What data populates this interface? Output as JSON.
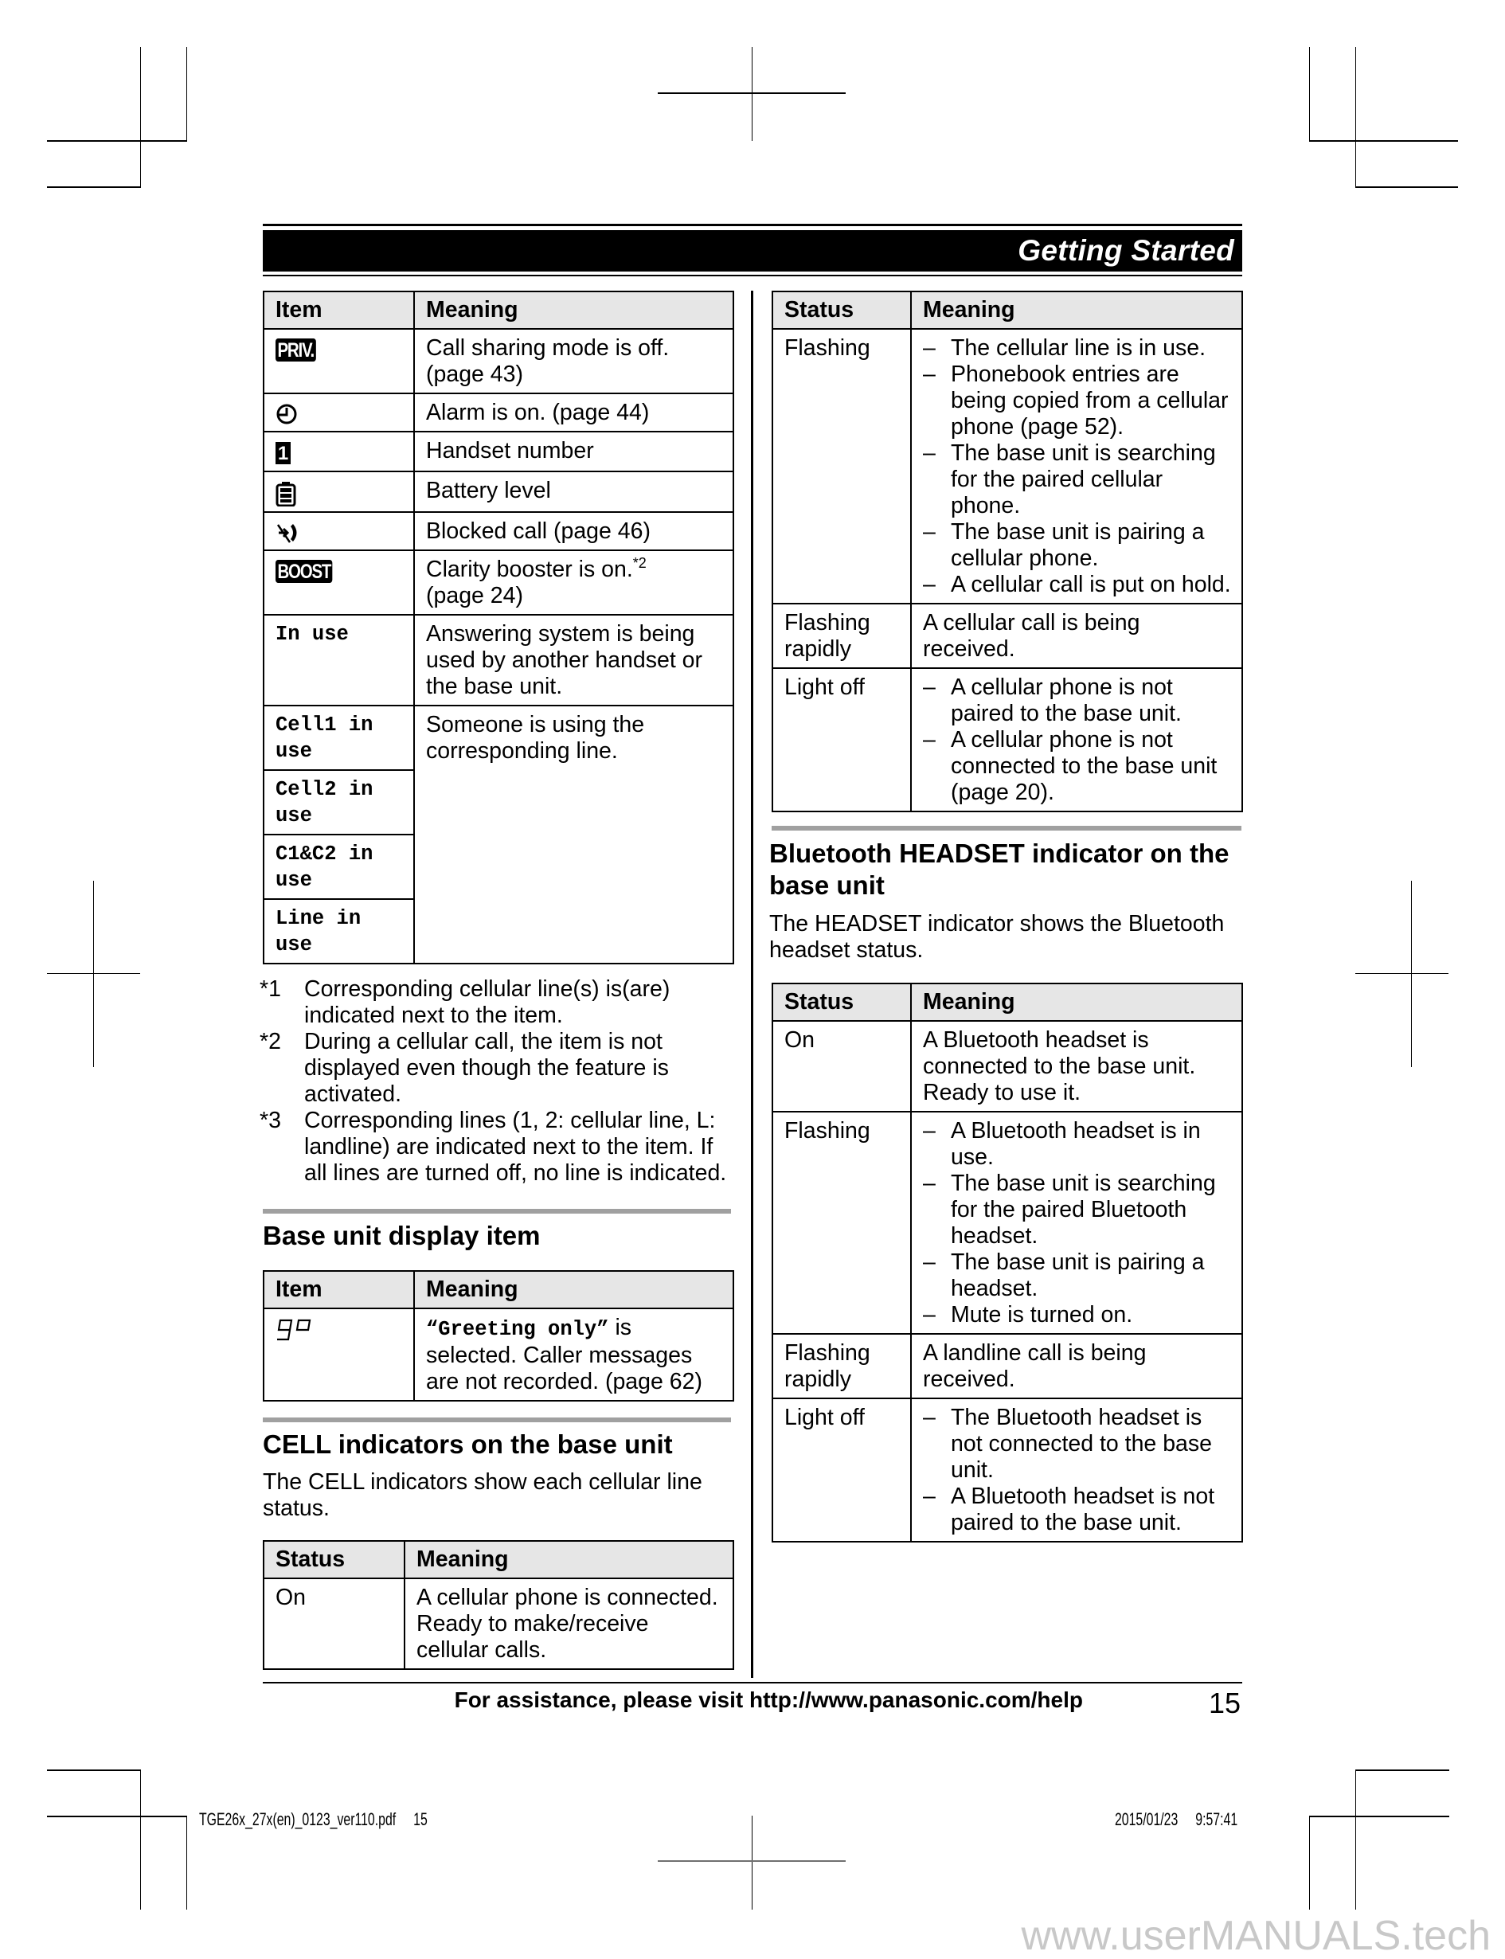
{
  "header": {
    "section_title": "Getting Started"
  },
  "handset_items_table": {
    "columns": [
      "Item",
      "Meaning"
    ],
    "rows": [
      {
        "item_icon": "priv-icon",
        "item_icon_text": "PRIV.",
        "meaning": [
          "Call sharing mode is off.",
          "(page 43)"
        ]
      },
      {
        "item_icon": "alarm-clock-icon",
        "meaning": [
          "Alarm is on. (page 44)"
        ]
      },
      {
        "item_icon": "handset-number-icon",
        "item_icon_text": "1",
        "meaning": [
          "Handset number"
        ]
      },
      {
        "item_icon": "battery-icon",
        "meaning": [
          "Battery level"
        ]
      },
      {
        "item_icon": "blocked-call-icon",
        "meaning": [
          "Blocked call (page 46)"
        ]
      },
      {
        "item_icon": "boost-icon",
        "item_icon_text": "BOOST",
        "meaning": [
          "Clarity booster is on.",
          "(page 24)"
        ],
        "meaning_sup": "*2"
      },
      {
        "item_text": "In use",
        "meaning": [
          "Answering system is being used by another handset or the base unit."
        ]
      },
      {
        "item_text": "Cell1 in use",
        "meaning": [
          "Someone is using the corresponding line."
        ]
      },
      {
        "item_text": "Cell2 in use"
      },
      {
        "item_text": "C1&C2 in use"
      },
      {
        "item_text": "Line in use"
      }
    ]
  },
  "footnotes": [
    {
      "mark": "*1",
      "text": "Corresponding cellular line(s) is(are) indicated next to the item."
    },
    {
      "mark": "*2",
      "text": "During a cellular call, the item is not displayed even though the feature is activated."
    },
    {
      "mark": "*3",
      "text": "Corresponding lines (1, 2: cellular line, L: landline) are indicated next to the item. If all lines are turned off, no line is indicated."
    }
  ],
  "base_unit_display": {
    "title": "Base unit display item",
    "columns": [
      "Item",
      "Meaning"
    ],
    "rows": [
      {
        "item_icon": "greeting-only-lcd-icon",
        "meaning_mono": "“Greeting only”",
        "meaning_rest": " is selected. Caller messages are not recorded. (page 62)"
      }
    ]
  },
  "cell_indicators": {
    "title": "CELL indicators on the base unit",
    "description": "The CELL indicators show each cellular line status.",
    "columns": [
      "Status",
      "Meaning"
    ],
    "rows": [
      {
        "status": "On",
        "meaning": "A cellular phone is connected. Ready to make/receive cellular calls."
      },
      {
        "status": "Flashing",
        "meaning_list": [
          "The cellular line is in use.",
          "Phonebook entries are being copied from a cellular phone (page 52).",
          "The base unit is searching for the paired cellular phone.",
          "The base unit is pairing a cellular phone.",
          "A cellular call is put on hold."
        ]
      },
      {
        "status": "Flashing rapidly",
        "meaning": "A cellular call is being received."
      },
      {
        "status": "Light off",
        "meaning_list": [
          "A cellular phone is not paired to the base unit.",
          "A cellular phone is not connected to the base unit (page 20)."
        ]
      }
    ]
  },
  "headset_indicator": {
    "title": "Bluetooth HEADSET indicator on the base unit",
    "description": "The HEADSET indicator shows the Bluetooth headset status.",
    "columns": [
      "Status",
      "Meaning"
    ],
    "rows": [
      {
        "status": "On",
        "meaning": "A Bluetooth headset is connected to the base unit. Ready to use it."
      },
      {
        "status": "Flashing",
        "meaning_list": [
          "A Bluetooth headset is in use.",
          "The base unit is searching for the paired Bluetooth headset.",
          "The base unit is pairing a headset.",
          "Mute is turned on."
        ]
      },
      {
        "status": "Flashing rapidly",
        "meaning": "A landline call is being received."
      },
      {
        "status": "Light off",
        "meaning_list": [
          "The Bluetooth headset is not connected to the base unit.",
          "A Bluetooth headset is not paired to the base unit."
        ]
      }
    ]
  },
  "footer": {
    "assistance_text": "For assistance, please visit http://www.panasonic.com/help",
    "page_number": "15"
  },
  "print_slug": {
    "file_name": "TGE26x_27x(en)_0123_ver110.pdf",
    "sheet_number": "15",
    "date": "2015/01/23",
    "time": "9:57:41"
  },
  "watermark": "www.userMANUALS.tech",
  "colors": {
    "table_header_bg": "#e6e6e6",
    "section_rule": "#a0a0a0",
    "header_bar": "#000000",
    "watermark": "#c8c8c8"
  }
}
